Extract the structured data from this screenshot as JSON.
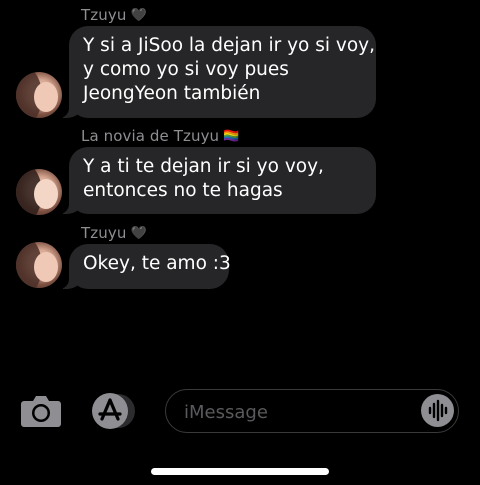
{
  "colors": {
    "background": "#000000",
    "bubble": "#262628",
    "sender_text": "#8e8e93",
    "placeholder": "#5a5a5e",
    "icon": "#8e8e93"
  },
  "messages": [
    {
      "sender": "Tzuyu",
      "sender_emoji": "🖤",
      "lines": [
        "Y si a JiSoo la dejan ir  yo si voy,",
        "y como yo si voy pues",
        "JeongYeon también"
      ]
    },
    {
      "sender": "La novia de Tzuyu",
      "sender_emoji": "🏳️‍🌈",
      "lines": [
        "Y a ti te dejan ir si yo voy,",
        "entonces no te hagas"
      ]
    },
    {
      "sender": "Tzuyu",
      "sender_emoji": "🖤",
      "lines": [
        "Okey, te amo :3"
      ]
    }
  ],
  "compose": {
    "placeholder": "iMessage",
    "camera_icon": "camera-icon",
    "apps_icon": "app-store-icon",
    "audio_icon": "audio-waveform-icon"
  }
}
